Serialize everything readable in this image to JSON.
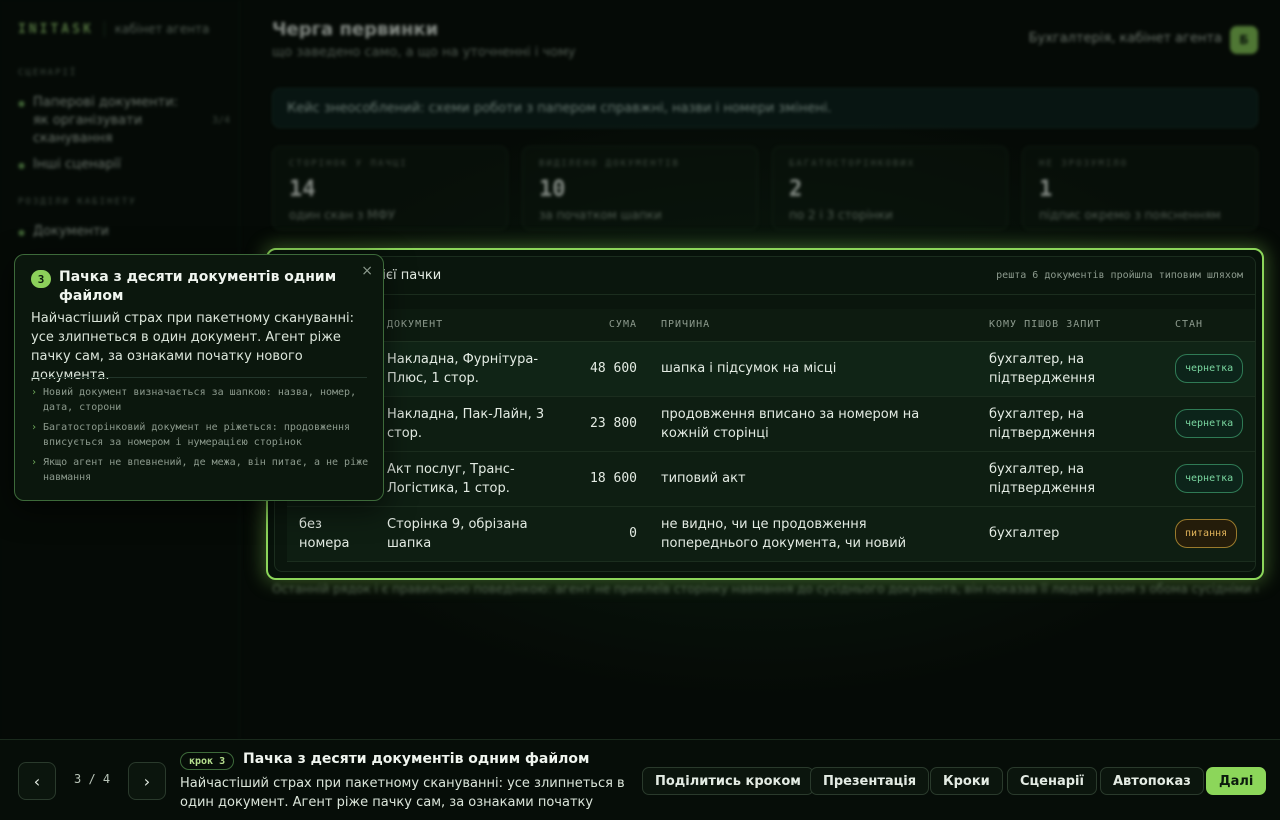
{
  "sidebar": {
    "logo": "INITASK",
    "subtitle": "кабінет агента",
    "section_scenarios": "СЦЕНАРІЇ",
    "scenario_items": [
      {
        "label": "Паперові документи: як організувати сканування",
        "count": "3/4"
      },
      {
        "label": "Інші сценарії"
      }
    ],
    "section_cabinet": "РОЗДІЛИ КАБІНЕТУ",
    "cabinet_items": [
      {
        "label": "Документи"
      }
    ]
  },
  "header": {
    "title": "Черга первинки",
    "subtitle": "що заведено само, а що на уточненні і чому",
    "user_label": "Бухгалтерія, кабінет агента",
    "avatar": "Б"
  },
  "notice": "Кейс знеособлений: схеми роботи з папером справжні, назви і номери змінені.",
  "stats": [
    {
      "caption": "СТОРІНОК У ПАЧЦІ",
      "value": "14",
      "note": "один скан з МФУ"
    },
    {
      "caption": "ВИДІЛЕНО ДОКУМЕНТІВ",
      "value": "10",
      "note": "за початком шапки"
    },
    {
      "caption": "БАГАТОСТОРІНКОВИХ",
      "value": "2",
      "note": "по 2 і 3 сторінки"
    },
    {
      "caption": "НЕ ЗРОЗУМІЛО",
      "value": "1",
      "note": "підпис окремо з поясненням"
    }
  ],
  "card": {
    "title": "т дістав з однієї пачки",
    "note": "решта 6 документів пройшла типовим шляхом",
    "columns": [
      "",
      "ДОКУМЕНТ",
      "СУМА",
      "ПРИЧИНА",
      "КОМУ ПІШОВ ЗАПИТ",
      "СТАН"
    ],
    "rows": [
      {
        "num": "",
        "doc": "Накладна, Фурнітура-Плюс, 1 стор.",
        "sum": "48 600",
        "reason": "шапка і підсумок на місці",
        "to": "бухгалтер, на підтвердження",
        "status": "чернетка",
        "warn": false
      },
      {
        "num": "",
        "doc": "Накладна, Пак-Лайн, 3 стор.",
        "sum": "23 800",
        "reason": "продовження вписано за номером на кожній сторінці",
        "to": "бухгалтер, на підтвердження",
        "status": "чернетка",
        "warn": false
      },
      {
        "num": "",
        "doc": "Акт послуг, Транс-Логістика, 1 стор.",
        "sum": "18 600",
        "reason": "типовий акт",
        "to": "бухгалтер, на підтвердження",
        "status": "чернетка",
        "warn": false
      },
      {
        "num": "без номера",
        "doc": "Сторінка 9, обрізана шапка",
        "sum": "0",
        "reason": "не видно, чи це продовження попереднього документа, чи новий",
        "to": "бухгалтер",
        "status": "питання",
        "warn": true
      }
    ]
  },
  "below_note": "Останній рядок і є правильною поведінкою: агент не приклеїв сторінку навмання до сусіднього документа, він показав її людям разом з обома сусідніми сторінками.",
  "popover": {
    "step": "3",
    "title": "Пачка з десяти документів одним файлом",
    "body": "Найчастіший страх при пакетному скануванні: усе злипнеться в один документ. Агент ріже пачку сам, за ознаками початку нового документа.",
    "bullets": [
      "Новий документ визначається за шапкою: назва, номер, дата, сторони",
      "Багатосторінковий документ не ріжеться: продовження вписується за номером і нумерацією сторінок",
      "Якщо агент не впевнений, де межа, він питає, а не ріже навмання"
    ],
    "close_glyph": "×"
  },
  "bottom": {
    "prev_glyph": "‹",
    "next_glyph": "›",
    "pager": "3 / 4",
    "step_tag": "крок 3",
    "step_title": "Пачка з десяти документів одним файлом",
    "step_desc": "Найчастіший страх при пакетному скануванні: усе злипнеться в один документ. Агент ріже пачку сам, за ознаками початку ново...",
    "buttons": {
      "share": "Поділитись кроком",
      "presentation": "Презентація",
      "steps": "Кроки",
      "scenarios": "Сценарії",
      "autoplay": "Автопоказ",
      "next": "Далі"
    }
  },
  "colors": {
    "accent": "#8cd65a",
    "draft": "#7ad6a0",
    "question": "#e0b35a"
  }
}
